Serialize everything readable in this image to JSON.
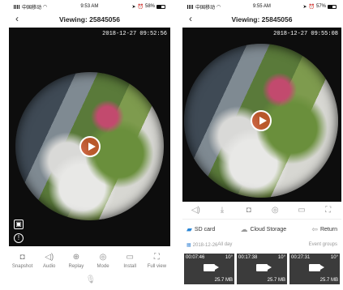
{
  "left": {
    "status": {
      "carrier": "中国移动",
      "time": "9:53 AM",
      "battery": "58%",
      "battery_level": 0.58
    },
    "title": "Viewing: 25845056",
    "back_icon": "chevron-left-icon",
    "timestamp": "2018-12-27 09:52:56",
    "controls": [
      {
        "icon": "camera-icon",
        "glyph": "◘",
        "label": "Snapshot"
      },
      {
        "icon": "speaker-icon",
        "glyph": "◁)",
        "label": "Audio"
      },
      {
        "icon": "replay-icon",
        "glyph": "⊕",
        "label": "Replay"
      },
      {
        "icon": "mode-icon",
        "glyph": "◎",
        "label": "Mode"
      },
      {
        "icon": "install-icon",
        "glyph": "▭",
        "label": "Install"
      },
      {
        "icon": "full-view-icon",
        "glyph": "⛶",
        "label": "Full view"
      }
    ]
  },
  "right": {
    "status": {
      "carrier": "中国移动",
      "time": "9:55 AM",
      "battery": "57%",
      "battery_level": 0.57
    },
    "title": "Viewing: 25845056",
    "timestamp": "2018-12-27 09:55:08",
    "icons": [
      {
        "icon": "speaker-icon",
        "glyph": "◁)"
      },
      {
        "icon": "download-icon",
        "glyph": "⤓"
      },
      {
        "icon": "camera-icon",
        "glyph": "◘"
      },
      {
        "icon": "mode-icon",
        "glyph": "◎"
      },
      {
        "icon": "install-icon",
        "glyph": "▭"
      },
      {
        "icon": "full-view-icon",
        "glyph": "⛶"
      }
    ],
    "storage": {
      "sd_card": "SD card",
      "cloud": "Cloud Storage",
      "return": "Return"
    },
    "date": "2018-12-26",
    "all_day": "All day",
    "event_groups": "Event groups",
    "clips": [
      {
        "time": "00:07:46",
        "angle": "10°",
        "size": "25.7 MB"
      },
      {
        "time": "00:17:38",
        "angle": "10°",
        "size": "25.7 MB"
      },
      {
        "time": "00:27:31",
        "angle": "10°",
        "size": "25.7 MB"
      }
    ]
  }
}
